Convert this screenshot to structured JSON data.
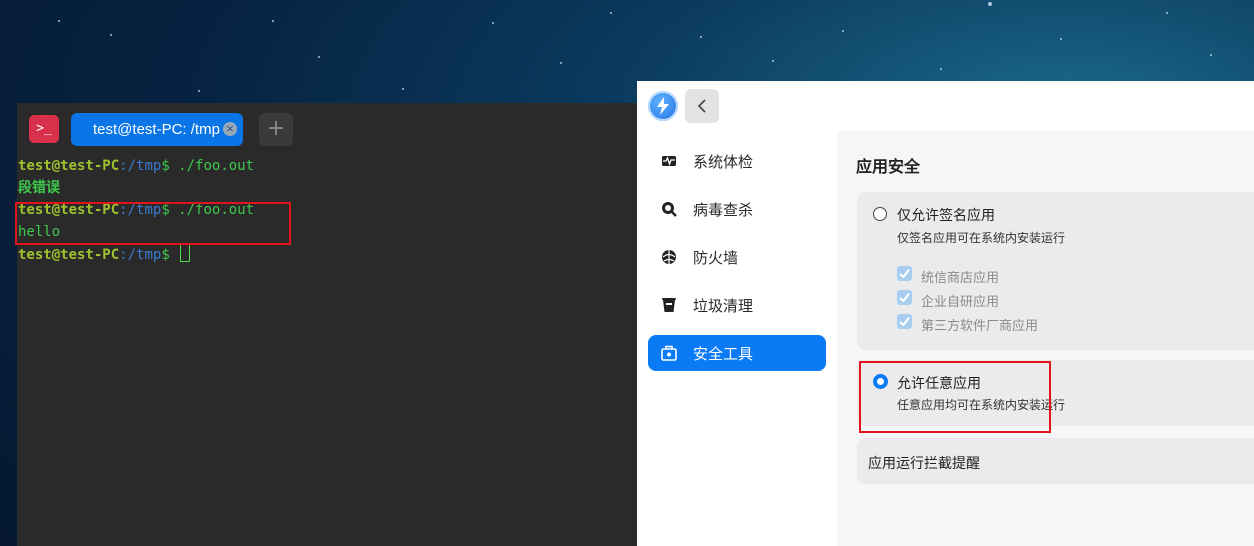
{
  "terminal": {
    "tab_title": "test@test-PC: /tmp",
    "lines": [
      {
        "user": "test@test-PC",
        "path": ":/tmp",
        "prompt": "$ ",
        "cmd": "./foo.out"
      },
      {
        "output": "段错误"
      },
      {
        "user": "test@test-PC",
        "path": ":/tmp",
        "prompt": "$ ",
        "cmd": "./foo.out"
      },
      {
        "output": "hello"
      },
      {
        "user": "test@test-PC",
        "path": ":/tmp",
        "prompt": "$ "
      }
    ]
  },
  "security_app": {
    "sidebar": [
      {
        "label": "系统体检",
        "icon": "pulse-monitor-icon"
      },
      {
        "label": "病毒查杀",
        "icon": "virus-scan-icon"
      },
      {
        "label": "防火墙",
        "icon": "firewall-icon"
      },
      {
        "label": "垃圾清理",
        "icon": "trash-icon"
      },
      {
        "label": "安全工具",
        "icon": "toolbox-icon",
        "active": true
      }
    ],
    "section_title": "应用安全",
    "option_signed": {
      "title": "仅允许签名应用",
      "desc": "仅签名应用可在系统内安装运行",
      "selected": false,
      "checks": [
        "统信商店应用",
        "企业自研应用",
        "第三方软件厂商应用"
      ]
    },
    "option_any": {
      "title": "允许任意应用",
      "desc": "任意应用均可在系统内安装运行",
      "selected": true
    },
    "intercept_label": "应用运行拦截提醒"
  },
  "colors": {
    "accent": "#0a7af5",
    "terminal_bg": "#2a2a2a",
    "highlight_box": "#e0141d"
  }
}
